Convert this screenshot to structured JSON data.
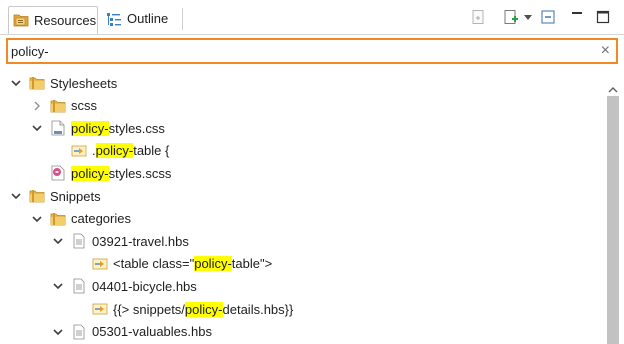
{
  "tabs": [
    {
      "label": "Resources",
      "icon": "resources-folder-icon",
      "active": true
    },
    {
      "label": "Outline",
      "icon": "outline-icon",
      "active": false
    }
  ],
  "toolbar": {
    "icons": [
      "link-with-editor-icon",
      "new-file-icon",
      "dropdown-arrow-icon",
      "collapse-all-icon",
      "minimize-icon",
      "maximize-icon"
    ]
  },
  "search": {
    "value": "policy-",
    "clear_glyph": "×"
  },
  "tree": {
    "rows": [
      {
        "pre": "",
        "hl": "",
        "post": "Stylesheets",
        "level": 0,
        "twisty": "open",
        "icon": "folder-icon"
      },
      {
        "pre": "",
        "hl": "",
        "post": "scss",
        "level": 1,
        "twisty": "closed",
        "icon": "folder-icon"
      },
      {
        "pre": "",
        "hl": "policy-",
        "post": "styles.css",
        "level": 1,
        "twisty": "open",
        "icon": "css-file-icon"
      },
      {
        "pre": ".",
        "hl": "policy-",
        "post": "table {",
        "level": 2,
        "twisty": "none",
        "icon": "css-rule-icon"
      },
      {
        "pre": "",
        "hl": "policy-",
        "post": "styles.scss",
        "level": 1,
        "twisty": "none",
        "icon": "scss-file-icon"
      },
      {
        "pre": "",
        "hl": "",
        "post": "Snippets",
        "level": 0,
        "twisty": "open",
        "icon": "folder-icon"
      },
      {
        "pre": "",
        "hl": "",
        "post": "categories",
        "level": 1,
        "twisty": "open",
        "icon": "folder-icon"
      },
      {
        "pre": "",
        "hl": "",
        "post": "03921-travel.hbs",
        "level": 2,
        "twisty": "open",
        "icon": "hbs-file-icon"
      },
      {
        "pre": "<table class=\"",
        "hl": "policy-",
        "post": "table\">",
        "level": 3,
        "twisty": "none",
        "icon": "snippet-match-icon"
      },
      {
        "pre": "",
        "hl": "",
        "post": "04401-bicycle.hbs",
        "level": 2,
        "twisty": "open",
        "icon": "hbs-file-icon"
      },
      {
        "pre": "{{> snippets/",
        "hl": "policy-",
        "post": "details.hbs}}",
        "level": 3,
        "twisty": "none",
        "icon": "snippet-match-icon"
      },
      {
        "pre": "",
        "hl": "",
        "post": "05301-valuables.hbs",
        "level": 2,
        "twisty": "open",
        "icon": "hbs-file-icon"
      }
    ]
  },
  "colors": {
    "highlight": "#ffff00",
    "search_border": "#f08a24",
    "folder": "#e8b84a"
  }
}
